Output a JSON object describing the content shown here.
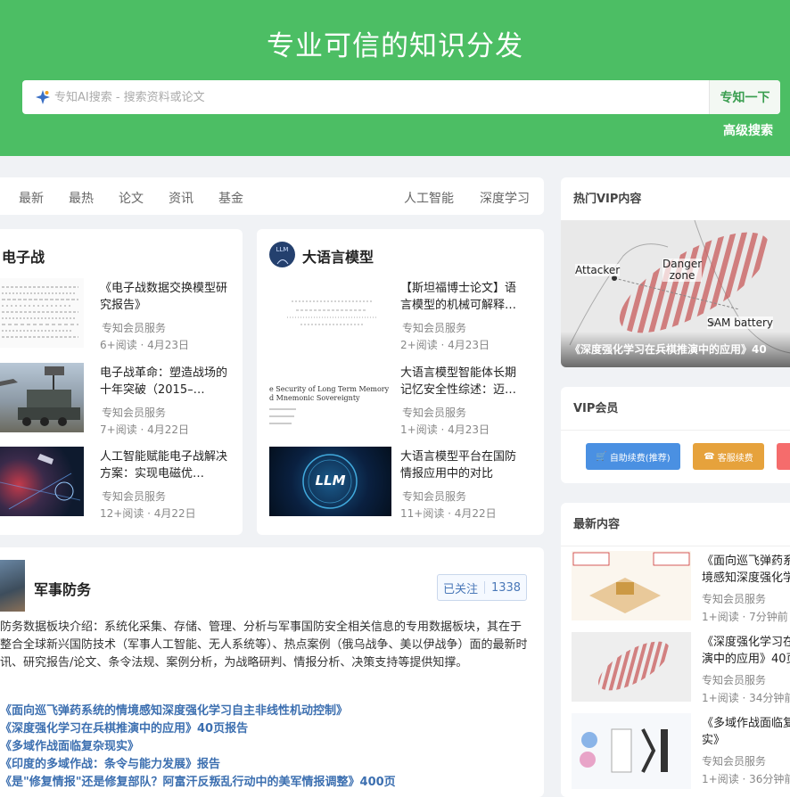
{
  "hero": {
    "title": "专业可信的知识分发",
    "search_placeholder": "专知AI搜索 - 搜索资料或论文",
    "search_button": "专知一下",
    "advanced_search": "高级搜索"
  },
  "tabs": {
    "left": [
      "最新",
      "最热",
      "论文",
      "资讯",
      "基金"
    ],
    "right": [
      "人工智能",
      "深度学习"
    ]
  },
  "topic_cards": [
    {
      "title": "电子战",
      "articles": [
        {
          "title": "《电子战数据交换模型研究报告》",
          "source": "专知会员服务",
          "meta": "6+阅读 · 4月23日"
        },
        {
          "title": "电子战革命：塑造战场的十年突破（2015–…",
          "source": "专知会员服务",
          "meta": "7+阅读 · 4月22日"
        },
        {
          "title": "人工智能赋能电子战解决方案：实现电磁优…",
          "source": "专知会员服务",
          "meta": "12+阅读 · 4月22日"
        }
      ]
    },
    {
      "title": "大语言模型",
      "avatar_text": "LLM",
      "articles": [
        {
          "title": "【斯坦福博士论文】语言模型的机械可解释…",
          "source": "专知会员服务",
          "meta": "2+阅读 · 4月23日"
        },
        {
          "title": "大语言模型智能体长期记忆安全性综述：迈…",
          "source": "专知会员服务",
          "meta": "1+阅读 · 4月23日",
          "thumb_text": "e Security of Long Term Memory\nd Mnemonic Sovereignty"
        },
        {
          "title": "大语言模型平台在国防情报应用中的对比",
          "source": "专知会员服务",
          "meta": "11+阅读 · 4月22日",
          "thumb_text": "LLM"
        }
      ]
    }
  ],
  "military": {
    "title": "军事防务",
    "follow_label": "已关注",
    "follow_count": "1338",
    "description": "防务数据板块介绍：系统化采集、存储、管理、分析与军事国防安全相关信息的专用数据板块，其在于整合全球新兴国防技术（军事人工智能、无人系统等）、热点案例（俄乌战争、美以伊战争）面的最新时讯、研究报告/论文、条令法规、案例分析，为战略研判、情报分析、决策支持等提供知撑。",
    "links": [
      "《面向巡飞弹药系统的情境感知深度强化学习自主非线性机动控制》",
      "《深度强化学习在兵棋推演中的应用》40页报告",
      "《多域作战面临复杂现实》",
      "《印度的多域作战：条令与能力发展》报告",
      "《是\"修复情报\"还是修复部队？阿富汗反叛乱行动中的美军情报调整》400页"
    ]
  },
  "sidebar": {
    "hot_vip": {
      "heading": "热门VIP内容",
      "image_labels": {
        "attacker": "Attacker",
        "danger": "Danger\nzone",
        "sam": "SAM battery"
      },
      "caption": "《深度强化学习在兵棋推演中的应用》40"
    },
    "vip": {
      "heading": "VIP会员",
      "buttons": [
        "自助续费(推荐)",
        "客服续费"
      ],
      "colors": {
        "blue": "#4a90e2",
        "orange": "#e6a23c",
        "red": "#f56c6c"
      }
    },
    "latest": {
      "heading": "最新内容",
      "items": [
        {
          "title": "《面向巡飞弹药系境感知深度强化学",
          "source": "专知会员服务",
          "meta": "1+阅读 · 7分钟前"
        },
        {
          "title": "《深度强化学习在演中的应用》40页",
          "source": "专知会员服务",
          "meta": "1+阅读 · 34分钟前"
        },
        {
          "title": "《多域作战面临复实》",
          "source": "专知会员服务",
          "meta": "1+阅读 · 36分钟前"
        }
      ]
    }
  },
  "colors": {
    "brand_green": "#4cbe64",
    "link_blue": "#3c6fb0"
  }
}
